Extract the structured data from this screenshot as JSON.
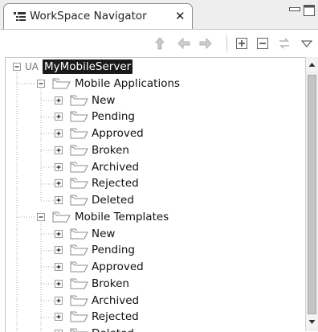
{
  "window": {
    "tab_title": "WorkSpace Navigator",
    "tab_icon": "navigator-view-icon",
    "close_glyph": "✕"
  },
  "toolbar": {
    "buttons": [
      {
        "name": "up-icon",
        "enabled": false
      },
      {
        "name": "back-arrow-icon",
        "enabled": false
      },
      {
        "name": "forward-arrow-icon",
        "enabled": false
      },
      {
        "name": "expand-all-icon",
        "enabled": true
      },
      {
        "name": "collapse-all-icon",
        "enabled": true
      },
      {
        "name": "link-with-editor-icon",
        "enabled": false
      },
      {
        "name": "view-menu-icon",
        "enabled": true
      }
    ]
  },
  "tree": {
    "root": {
      "prefix": "UA",
      "label": "MyMobileServer",
      "expanded": true,
      "selected": true
    },
    "groups": [
      {
        "label": "Mobile Applications",
        "expanded": true,
        "children": [
          "New",
          "Pending",
          "Approved",
          "Broken",
          "Archived",
          "Rejected",
          "Deleted"
        ]
      },
      {
        "label": "Mobile Templates",
        "expanded": true,
        "children": [
          "New",
          "Pending",
          "Approved",
          "Broken",
          "Archived",
          "Rejected",
          "Deleted"
        ]
      }
    ]
  },
  "colors": {
    "selection_bg": "#1a1a1a",
    "selection_fg": "#ffffff",
    "folder": "#9a9a9a",
    "disabled_icon": "#b8b8b8"
  }
}
